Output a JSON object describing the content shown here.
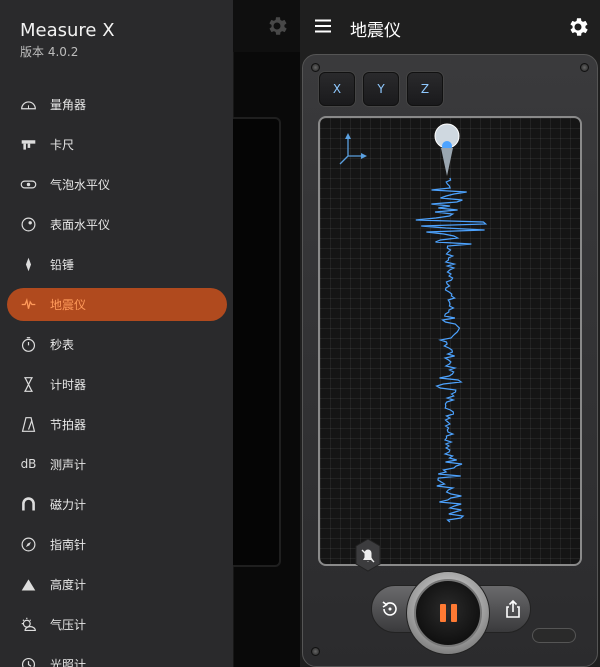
{
  "drawer": {
    "app_title": "Measure X",
    "version": "版本 4.0.2",
    "items": [
      {
        "label": "量角器",
        "icon": "protractor-icon"
      },
      {
        "label": "卡尺",
        "icon": "caliper-icon"
      },
      {
        "label": "气泡水平仪",
        "icon": "bubble-level-icon"
      },
      {
        "label": "表面水平仪",
        "icon": "surface-level-icon"
      },
      {
        "label": "铅锤",
        "icon": "plumb-bob-icon"
      },
      {
        "label": "地震仪",
        "icon": "seismometer-icon",
        "active": true
      },
      {
        "label": "秒表",
        "icon": "stopwatch-icon"
      },
      {
        "label": "计时器",
        "icon": "hourglass-icon"
      },
      {
        "label": "节拍器",
        "icon": "metronome-icon"
      },
      {
        "label": "测声计",
        "icon": "decibel-icon",
        "glyph": "dB"
      },
      {
        "label": "磁力计",
        "icon": "magnet-icon"
      },
      {
        "label": "指南针",
        "icon": "compass-icon"
      },
      {
        "label": "高度计",
        "icon": "mountain-icon"
      },
      {
        "label": "气压计",
        "icon": "barometer-icon"
      },
      {
        "label": "光照计",
        "icon": "light-meter-icon"
      }
    ]
  },
  "seismometer": {
    "title": "地震仪",
    "axis_buttons": [
      "X",
      "Y",
      "Z"
    ]
  },
  "colors": {
    "accent": "#ff7a33",
    "active_bg": "#b04a1e",
    "axis_label": "#8fc9ff",
    "wave": "#4da3ff"
  }
}
